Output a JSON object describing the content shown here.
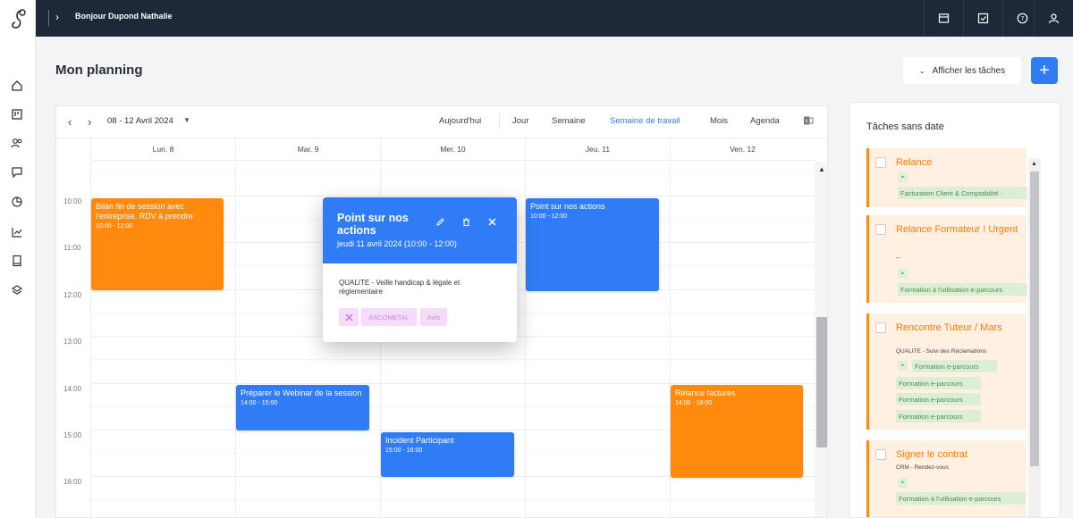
{
  "topbar": {
    "greeting": "Bonjour Dupond Nathalie",
    "icons": [
      "calendar-icon",
      "checkbox-icon",
      "help-icon",
      "user-icon"
    ]
  },
  "sidebar": {
    "icons": [
      "logo-icon",
      "home-icon",
      "board-icon",
      "users-icon",
      "chat-icon",
      "pie-chart-icon",
      "trend-icon",
      "book-icon",
      "layers-icon"
    ]
  },
  "page": {
    "title": "Mon planning",
    "show_tasks": "Afficher les tâches",
    "add": "+"
  },
  "calendar": {
    "range": "08 - 12 Avril 2024",
    "views": {
      "today": "Aujourd'hui",
      "day": "Jour",
      "week": "Semaine",
      "workweek": "Semaine de travail",
      "month": "Mois",
      "agenda": "Agenda"
    },
    "active_view": "Semaine de travail",
    "days": [
      "Lun. 8",
      "Mar. 9",
      "Mer. 10",
      "Jeu. 11",
      "Ven. 12"
    ],
    "times": [
      "10:00",
      "11:00",
      "12:00",
      "13:00",
      "14:00",
      "15:00",
      "16:00"
    ],
    "events": [
      {
        "title": "Bilan fin de session avec l'entreprise. RDV à prendre",
        "hours": "10:00 - 12:00",
        "day": "Lun. 8",
        "color": "#ff8a0d"
      },
      {
        "title": "Point sur nos actions",
        "hours": "10:00 - 12:00",
        "day": "Jeu. 11",
        "color": "#2f7cf6"
      },
      {
        "title": "Préparer le Webinar de la session",
        "hours": "14:00 - 15:00",
        "day": "Mar. 9",
        "color": "#2f7cf6"
      },
      {
        "title": "Incident Participant",
        "hours": "15:00 - 16:00",
        "day": "Mer. 10",
        "color": "#2f7cf6"
      },
      {
        "title": "Relance factures",
        "hours": "14:00 - 16:00",
        "day": "Ven. 12",
        "color": "#ff8a0d"
      }
    ]
  },
  "popup": {
    "title": "Point sur nos actions",
    "date": "jeudi 11 avril 2024 (10:00 - 12:00)",
    "description": "QUALITE - Veille handicap & légale et réglementaire",
    "chips": [
      "ASCOMETAL",
      "Avto"
    ]
  },
  "tasks_panel": {
    "title": "Tâches sans date",
    "tasks": [
      {
        "title": "Relance",
        "tags": [
          "Facturation Client & Comptabilité -"
        ]
      },
      {
        "title": "Relance Formateur ! Urgent",
        "dash": "--",
        "tags": [
          "Formation à l'utilisation e-parcours"
        ]
      },
      {
        "title": "Rencontre Tuteur / Mars",
        "subtitle": "QUALITE - Suivi des Réclamations",
        "tags": [
          "Formation e-parcours",
          "Formation e-parcours",
          "Formation e-parcours",
          "Formation e-parcours"
        ]
      },
      {
        "title": "Signer le contrat",
        "subtitle": "CRM - Rendez-vous",
        "tags": [
          "Formation à l'utilisation e-parcours"
        ]
      }
    ]
  },
  "colors": {
    "accent": "#2f7cf6",
    "orange": "#ff8a0d",
    "topbar": "#1d2939"
  }
}
